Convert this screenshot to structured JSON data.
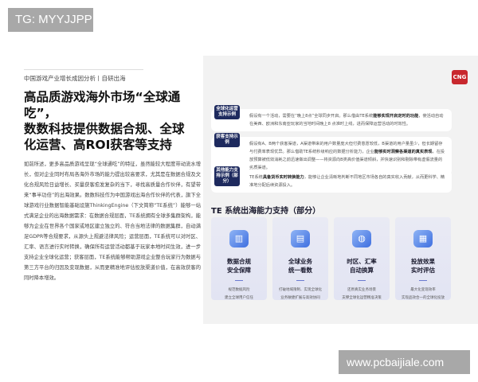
{
  "watermarks": {
    "top": "TG: MYYJJPP",
    "bottom": "www.pcbaijiale.com"
  },
  "left": {
    "subtitle": "中国游戏产业增长成因分析丨自研出海",
    "title": [
      "高品质游戏海外市场“全球通吃”，",
      "数数科技提供数据合规、全球",
      "化运营、高ROI获客等支持"
    ],
    "body": "如前所述，更多高品质游戏呈现“全球通吃”的特征，虽然能较大程度带动流水增长，但对企业同时布局各海外市场的能力提出较高要求，尤其是在数据合规及文化合规风险日益增长、买量获客愈发复杂的当下，寻找高质量合作伙伴，有望带来“事半功倍”的出海效果。数数科技作为中国游戏出海合作伙伴的代表，旗下全球游戏行业数据智能基础设施ThinkingEngine（下文简称“TE系统”）能够一站式满足企业的出海数据需求：在数据合规层面，TE系统拥有全球多集群架构，能够为企业在世界各个国家或地区建立独立的、符合当地法律的数据集群，自动满足GDPR等合规要求，从源头上规避法律风险；运营层面，TE系统可以对时区、汇率、语言进行实时转换，确保所有运营活动都基于玩家本地时间生效，进一步支持企业全球化运营；获客层面，TE系统能够帮助游戏企业整合玩家行为数据与第三方平台的归因及变现数据，从而更精准地评估投放渠道价值，在高效获客的同时降本增效。"
  },
  "right": {
    "logo": "CNG",
    "examples": [
      {
        "tag": "全球化运营支持示例",
        "pre": "假设有一个活动，需要在“晚上8点”全球同步开启。那么借由TE系统",
        "bold": "能够实现开启定时的功能",
        "post": "，使活动自动在美西、欧洲和东南亚玩家的当地时间晚上8 点准时上线，进而保障运营活动的时效性。"
      },
      {
        "tag": "获客支持示例",
        "pre": "假设有A、B两个获客渠道，A渠道带来的用户数量庞大但付费意愿较低，B渠道的用户量虽少，但长期留存与付费率表现优异。那么借助TE系统秒级响应的数据分析能力，企业",
        "bold": "能够实时洞察各渠道的真实表现",
        "post": "，在投放预算被低效消耗之前迅速做出调整——将资源向B类高价值渠道倾斜，并快速识别和剔除带有虚假流量的劣质渠道。"
      },
      {
        "tag": "其他能力支持示例（部分）",
        "pre": "TE系统",
        "bold": "具备货币实时转换能力",
        "post": "，能够让企业清晰地判断不同地区市场各自的真实收入贡献，从而更科学、精准地分配后续资源投入。"
      }
    ],
    "caption": "TE 系统出海能力支持（部分）",
    "cards": [
      {
        "icon": "chart-icon",
        "title": [
          "数据合规",
          "安全保障"
        ],
        "desc": [
          "规范数据风险",
          "建立全球用户信任"
        ]
      },
      {
        "icon": "dashboard-icon",
        "title": [
          "全球业务",
          "统一看数"
        ],
        "desc": [
          "打破地域限制、实现全球化",
          "业务敏捷扩展与高效协同"
        ]
      },
      {
        "icon": "globe-icon",
        "title": [
          "时区、汇率",
          "自动换算"
        ],
        "desc": [
          "还原真实业务场景",
          "支撑全球化运营精准决策"
        ]
      },
      {
        "icon": "report-icon",
        "title": [
          "投放效果",
          "实时评估"
        ],
        "desc": [
          "最大化变现效率",
          "实现品效合一的全球化投放"
        ]
      }
    ]
  },
  "colors": {
    "accent": "#1e2a5e",
    "logo": "#c8282e",
    "panel": "#f2f2f2"
  }
}
